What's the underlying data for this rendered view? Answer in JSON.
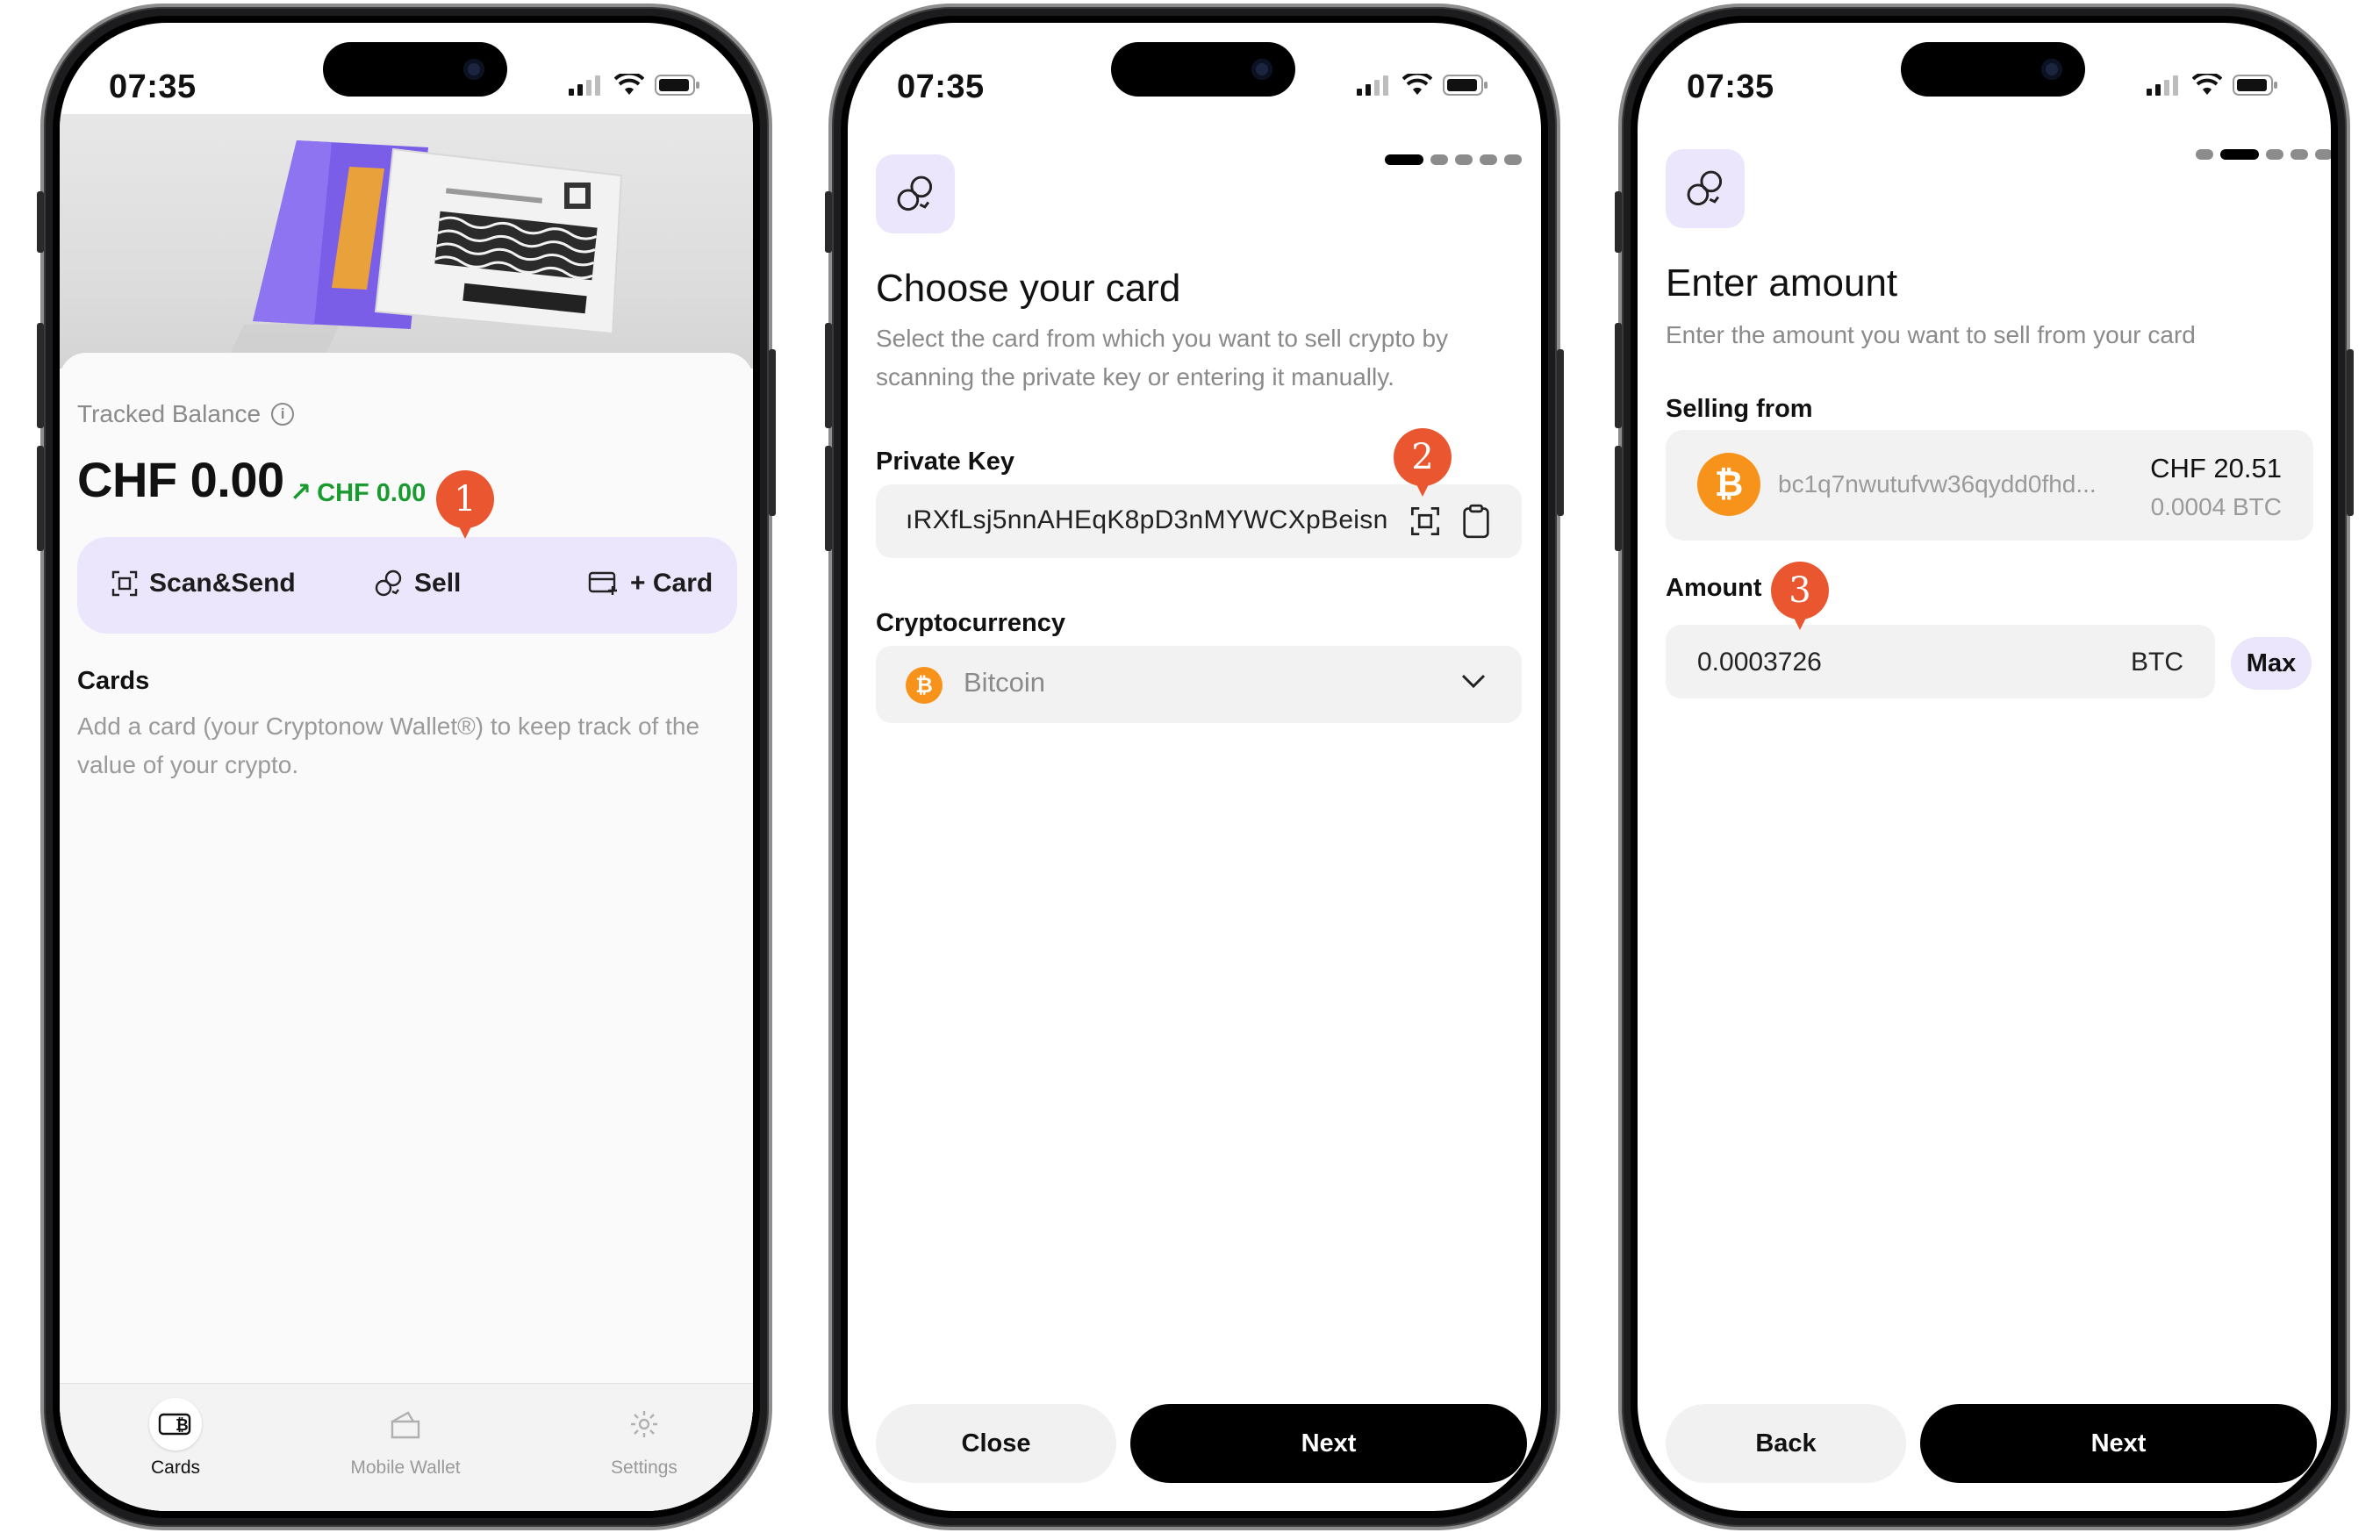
{
  "status": {
    "time": "07:35"
  },
  "screen1": {
    "tracked_label": "Tracked Balance",
    "balance": "CHF 0.00",
    "delta": "CHF 0.00",
    "actions": {
      "scan": "Scan&Send",
      "sell": "Sell",
      "card": "+ Card"
    },
    "cards_title": "Cards",
    "cards_hint": "Add a card (your Cryptonow Wallet®) to keep track of the value of your crypto.",
    "tabs": [
      {
        "label": "Cards",
        "icon": "bitcoin-card-icon"
      },
      {
        "label": "Mobile Wallet",
        "icon": "wallet-icon"
      },
      {
        "label": "Settings",
        "icon": "gear-icon"
      }
    ],
    "marker": "1"
  },
  "screen2": {
    "title": "Choose your card",
    "subtitle": "Select the card from which you want to sell crypto by scanning the private key or entering it manually.",
    "private_key_label": "Private Key",
    "private_key_value": "ıRXfLsj5nnAHEqK8pD3nMYWCXpBeisn",
    "crypto_label": "Cryptocurrency",
    "crypto_value": "Bitcoin",
    "close": "Close",
    "next": "Next",
    "marker": "2",
    "step": 1
  },
  "screen3": {
    "title": "Enter amount",
    "subtitle": "Enter the amount you want to sell from your card",
    "selling_from_label": "Selling from",
    "address": "bc1q7nwutufvw36qydd0fhd...",
    "fiat": "CHF 20.51",
    "btc": "0.0004 BTC",
    "amount_label": "Amount",
    "amount_value": "0.0003726",
    "amount_unit": "BTC",
    "max": "Max",
    "back": "Back",
    "next": "Next",
    "marker": "3",
    "step": 2
  },
  "colors": {
    "accent_purple": "#ebe6fb",
    "bitcoin_orange": "#f7931a",
    "marker_red": "#e9562f",
    "positive_green": "#1a9b2f"
  }
}
